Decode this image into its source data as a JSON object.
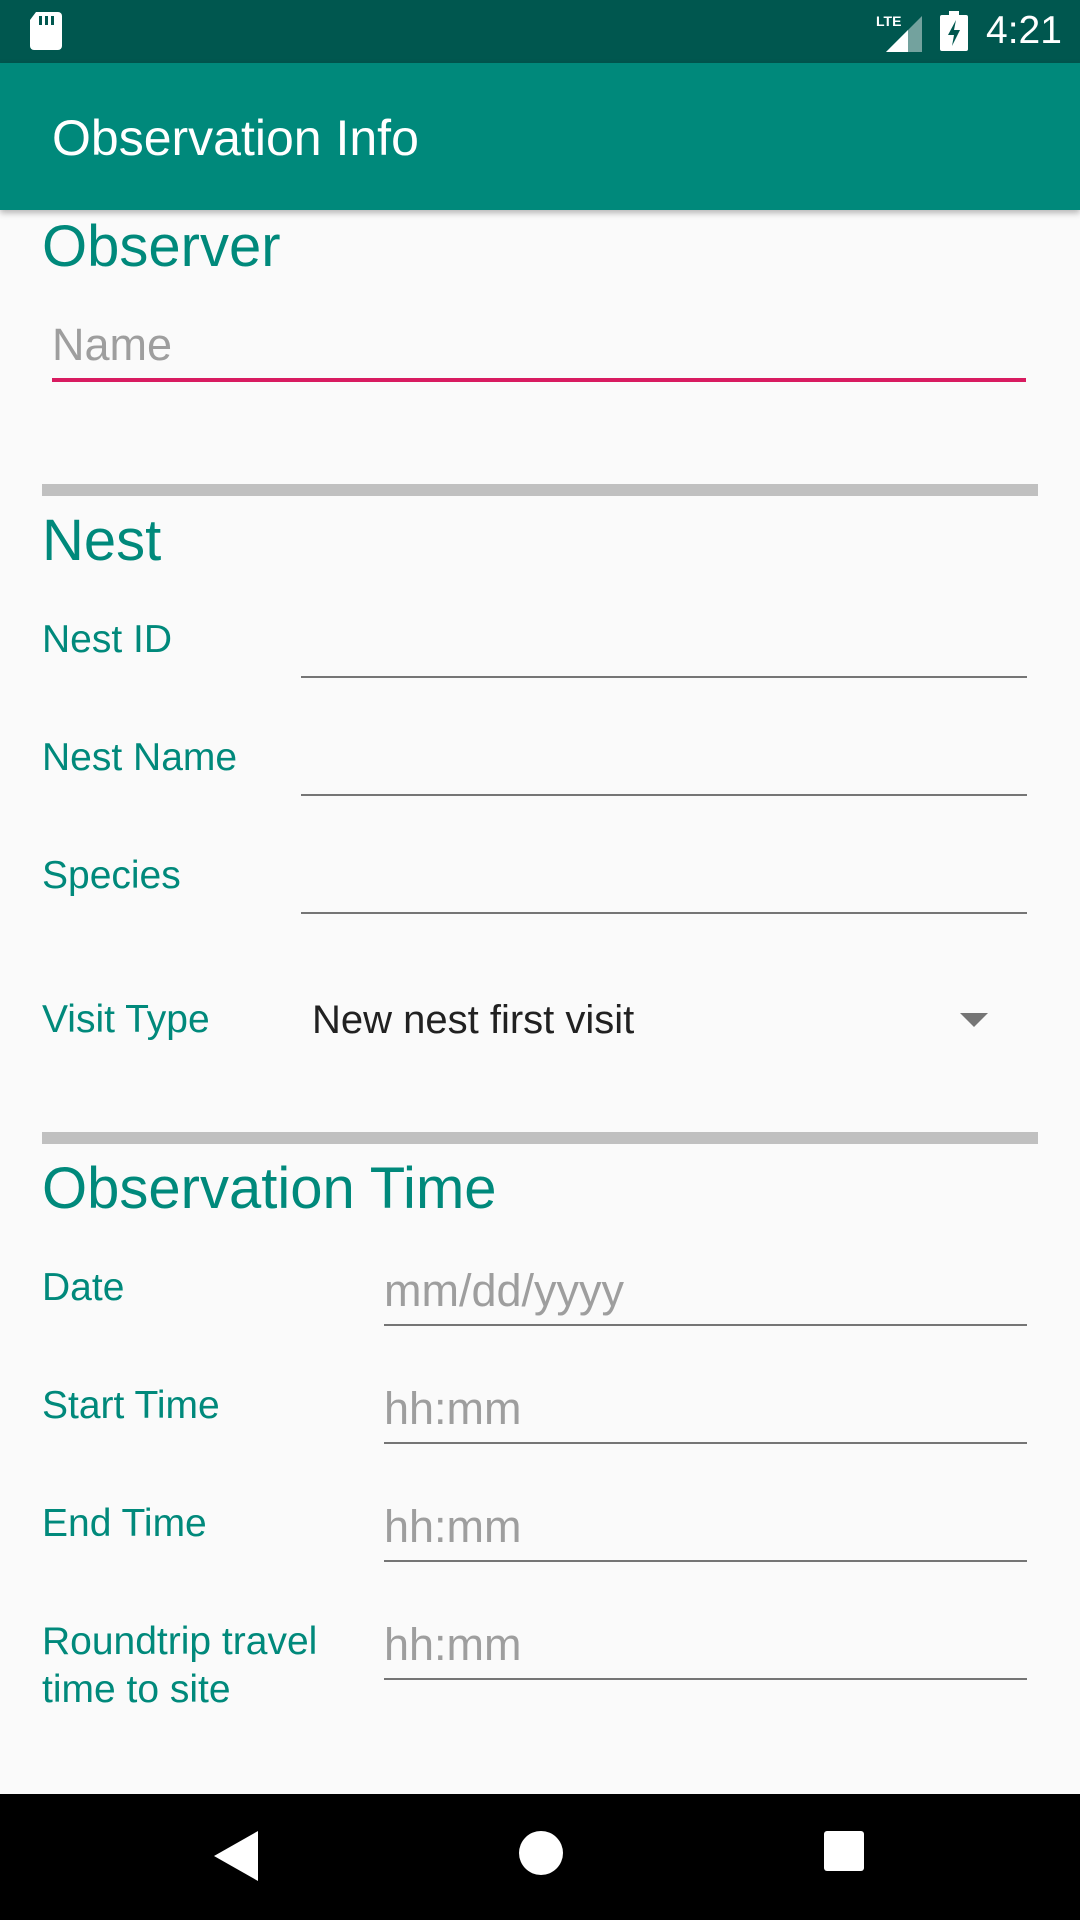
{
  "status_bar": {
    "time": "4:21",
    "network": "LTE"
  },
  "app_bar": {
    "title": "Observation Info"
  },
  "observer_section": {
    "title": "Observer",
    "name_placeholder": "Name",
    "name_value": ""
  },
  "nest_section": {
    "title": "Nest",
    "nest_id_label": "Nest ID",
    "nest_id_value": "",
    "nest_name_label": "Nest Name",
    "nest_name_value": "",
    "species_label": "Species",
    "species_value": "",
    "visit_type_label": "Visit Type",
    "visit_type_selected": "New nest first visit"
  },
  "time_section": {
    "title": "Observation Time",
    "date_label": "Date",
    "date_placeholder": "mm/dd/yyyy",
    "start_label": "Start Time",
    "start_placeholder": "hh:mm",
    "end_label": "End Time",
    "end_placeholder": "hh:mm",
    "travel_label": "Roundtrip travel time to site",
    "travel_placeholder": "hh:mm"
  },
  "colors": {
    "primary": "#00897b",
    "primary_dark": "#00574f",
    "accent": "#d81b60"
  }
}
